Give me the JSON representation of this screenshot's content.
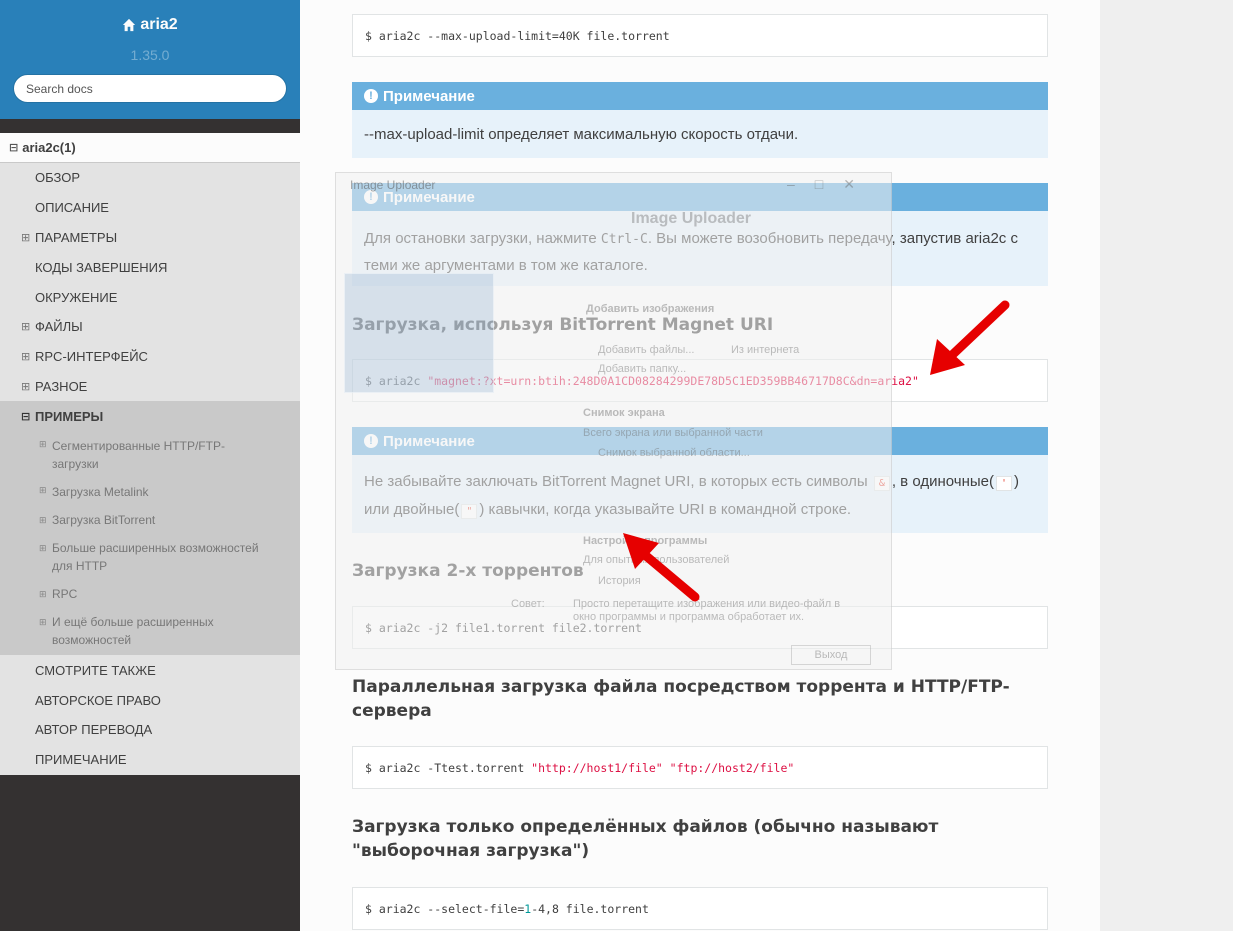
{
  "sidebar": {
    "brand": "aria2",
    "version": "1.35.0",
    "search_placeholder": "Search docs",
    "top_item": "aria2c(1)",
    "items_before": [
      "ОБЗОР",
      "ОПИСАНИЕ",
      "ПАРАМЕТРЫ",
      "КОДЫ ЗАВЕРШЕНИЯ",
      "ОКРУЖЕНИЕ",
      "ФАЙЛЫ",
      "RPC-ИНТЕРФЕЙС",
      "РАЗНОЕ"
    ],
    "current": "ПРИМЕРЫ",
    "subitems": [
      "Сегментированные HTTP/FTP-загрузки",
      "Загрузка Metalink",
      "Загрузка BitTorrent",
      "Больше расширенных возможностей для HTTP",
      "RPC",
      "И ещё больше расширенных возможностей"
    ],
    "items_after": [
      "СМОТРИТЕ ТАКЖЕ",
      "АВТОРСКОЕ ПРАВО",
      "АВТОР ПЕРЕВОДА",
      "ПРИМЕЧАНИЕ"
    ]
  },
  "content": {
    "code1": "$ aria2c --max-upload-limit=40K file.torrent",
    "note_label": "Примечание",
    "note1": "--max-upload-limit определяет максимальную скорость отдачи.",
    "note2_a": "Для остановки загрузки, нажмите ",
    "note2_kbd": "Ctrl-C",
    "note2_b": ". Вы можете возобновить передачу, запустив aria2c с теми же аргументами в том же каталоге.",
    "h_magnet": "Загрузка, используя BitTorrent Magnet URI",
    "code2_cmd": "$ aria2c ",
    "code2_str": "\"magnet:?xt=urn:btih:248D0A1CD08284299DE78D5C1ED359BB46717D8C&dn=aria2\"",
    "note3_a": "Не забывайте заключать BitTorrent Magnet URI, в которых есть символы ",
    "note3_amp": "&",
    "note3_b": ", в одиночные(",
    "note3_sq": "'",
    "note3_c": ") или двойные(",
    "note3_dq": "\"",
    "note3_d": ") кавычки, когда указывайте URI в командной строке.",
    "h_two": "Загрузка 2-х торрентов",
    "code3": "$ aria2c -j2 file1.torrent file2.torrent",
    "h_parallel": "Параллельная загрузка файла посредством торрента и HTTP/FTP-сервера",
    "code4_cmd": "$ aria2c -Ttest.torrent ",
    "code4_s1": "\"http://host1/file\"",
    "code4_s2": "\"ftp://host2/file\"",
    "h_select": "Загрузка только определённых файлов (обычно называют \"выборочная загрузка\")",
    "code5_a": "$ aria2c --select-file=",
    "code5_n": "1",
    "code5_b": "-4,8 file.torrent"
  },
  "ghost_window": {
    "title": "Image Uploader",
    "heading": "Image Uploader",
    "lines": [
      "Добавить изображения",
      "Добавить файлы...",
      "Из интернета",
      "Добавить папку...",
      "Снимок экрана",
      "Всего экрана или выбранной части",
      "Снимок выбранной области...",
      "Настройки программы",
      "Для опытных пользователей",
      "История",
      "Совет:",
      "Просто перетащите изображения или видео-файл в окно программы и программа обработает их."
    ],
    "exit_button": "Выход"
  },
  "colors": {
    "sidebar_bg": "#343131",
    "brand_bg": "#2980b9",
    "note_title": "#6ab0de",
    "note_body": "#e7f2fa",
    "arrow": "#e60000"
  }
}
